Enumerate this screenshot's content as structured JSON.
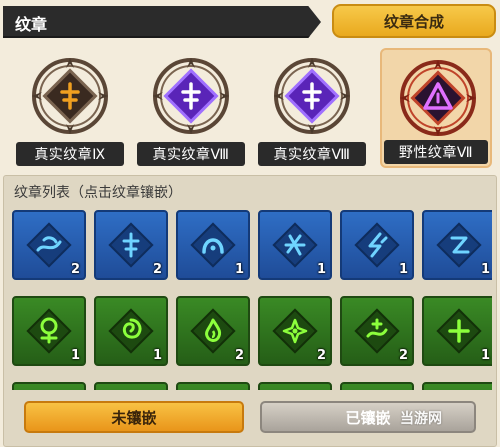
{
  "header": {
    "title": "纹章",
    "synthesis_button": "纹章合成"
  },
  "equipped_slots": [
    {
      "label": "真实纹章Ⅸ",
      "rune_color": "#f0a020",
      "gem_color": "#3a2a20",
      "glyph": "dagger-rune"
    },
    {
      "label": "真实纹章Ⅷ",
      "rune_color": "#ffffff",
      "gem_color": "#6a2ad0",
      "glyph": "dagger-rune"
    },
    {
      "label": "真实纹章Ⅷ",
      "rune_color": "#ffffff",
      "gem_color": "#6a2ad0",
      "glyph": "dagger-rune"
    },
    {
      "label": "野性纹章Ⅶ",
      "rune_color": "#e070ff",
      "gem_color": "#5a1a70",
      "glyph": "triangle-rune",
      "selected": true
    }
  ],
  "list": {
    "title": "纹章列表（点击纹章镶嵌）",
    "rows": [
      [
        {
          "theme": "blue",
          "glyph": "wave-rune",
          "count": "2"
        },
        {
          "theme": "blue",
          "glyph": "dagger-rune",
          "count": "2"
        },
        {
          "theme": "blue",
          "glyph": "arch-rune",
          "count": "1"
        },
        {
          "theme": "blue",
          "glyph": "cross-rune",
          "count": "1"
        },
        {
          "theme": "blue",
          "glyph": "bolt-rune",
          "count": "1"
        },
        {
          "theme": "blue",
          "glyph": "zigzag-rune",
          "count": "1"
        }
      ],
      [
        {
          "theme": "green",
          "glyph": "tree-rune",
          "count": "1"
        },
        {
          "theme": "green",
          "glyph": "swirl-rune",
          "count": "1"
        },
        {
          "theme": "green",
          "glyph": "flame-rune",
          "count": "2"
        },
        {
          "theme": "green",
          "glyph": "star-rune",
          "count": "2"
        },
        {
          "theme": "green",
          "glyph": "dagger-wave-rune",
          "count": "2"
        },
        {
          "theme": "green",
          "glyph": "cross-rune",
          "count": "1"
        }
      ]
    ]
  },
  "buttons": {
    "unset": "未镶嵌",
    "set": "已镶嵌"
  },
  "watermark": "当游网",
  "colors": {
    "blue_rune": "#6fd4ff",
    "green_rune": "#8cff3c"
  }
}
